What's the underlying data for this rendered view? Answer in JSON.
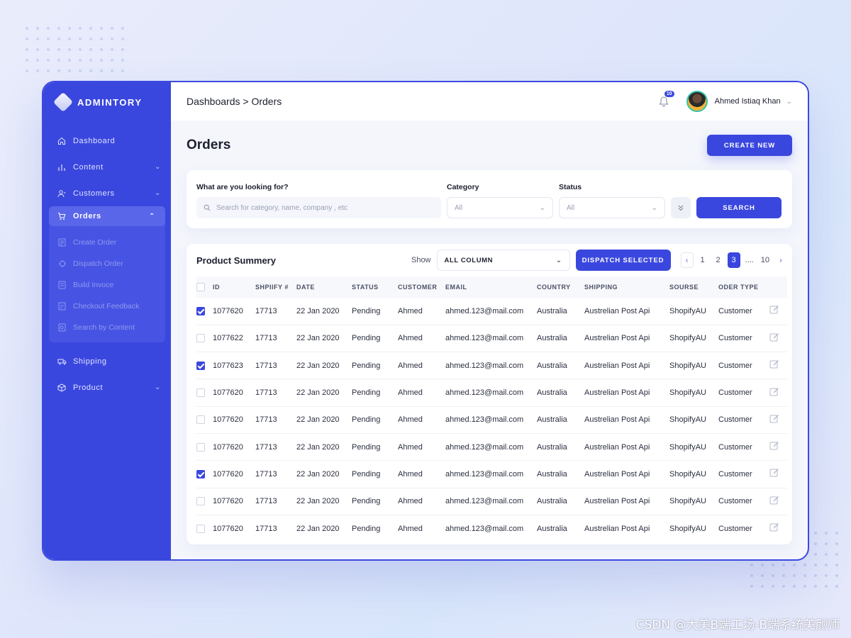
{
  "brand": {
    "name": "ADMINTORY"
  },
  "sidebar": {
    "items": [
      {
        "label": "Dashboard",
        "icon": "home-icon"
      },
      {
        "label": "Content",
        "icon": "bar-chart-icon"
      },
      {
        "label": "Customers",
        "icon": "user-icon"
      },
      {
        "label": "Orders",
        "icon": "cart-icon"
      },
      {
        "label": "Shipping",
        "icon": "truck-icon"
      },
      {
        "label": "Product",
        "icon": "box-icon"
      }
    ],
    "orders_sub": [
      {
        "label": "Create Order",
        "icon": "document-icon"
      },
      {
        "label": "Dispatch Order",
        "icon": "dispatch-icon"
      },
      {
        "label": "Build Invoce",
        "icon": "invoice-icon"
      },
      {
        "label": "Checkout Feedback",
        "icon": "feedback-icon"
      },
      {
        "label": "Search by Content",
        "icon": "search-doc-icon"
      }
    ]
  },
  "topbar": {
    "breadcrumb": "Dashboards > Orders",
    "notification_count": "10",
    "user_name": "Ahmed Istiaq Khan"
  },
  "page": {
    "title": "Orders",
    "create_label": "CREATE NEW"
  },
  "filters": {
    "search_label": "What are you looking for?",
    "search_placeholder": "Search for category, name, company , etc",
    "category_label": "Category",
    "category_value": "All",
    "status_label": "Status",
    "status_value": "All",
    "search_button": "SEARCH"
  },
  "summary": {
    "title": "Product Summery",
    "show_label": "Show",
    "column_select": "ALL COLUMN",
    "dispatch_label": "DISPATCH SELECTED",
    "pages": [
      "1",
      "2",
      "3",
      "....",
      "10"
    ],
    "current_page": "3"
  },
  "table": {
    "headers": [
      "ID",
      "SHPIIFY #",
      "DATE",
      "STATUS",
      "CUSTOMER",
      "EMAIL",
      "COUNTRY",
      "SHIPPING",
      "SOURSE",
      "ODER TYPE"
    ],
    "rows": [
      {
        "checked": true,
        "id": "1077620",
        "shopify": "17713",
        "date": "22 Jan 2020",
        "status": "Pending",
        "customer": "Ahmed",
        "email": "ahmed.123@mail.com",
        "country": "Australia",
        "shipping": "Austrelian Post Api",
        "source": "ShopifyAU",
        "type": "Customer"
      },
      {
        "checked": false,
        "id": "1077622",
        "shopify": "17713",
        "date": "22 Jan 2020",
        "status": "Pending",
        "customer": "Ahmed",
        "email": "ahmed.123@mail.com",
        "country": "Australia",
        "shipping": "Austrelian Post Api",
        "source": "ShopifyAU",
        "type": "Customer"
      },
      {
        "checked": true,
        "id": "1077623",
        "shopify": "17713",
        "date": "22 Jan 2020",
        "status": "Pending",
        "customer": "Ahmed",
        "email": "ahmed.123@mail.com",
        "country": "Australia",
        "shipping": "Austrelian Post Api",
        "source": "ShopifyAU",
        "type": "Customer"
      },
      {
        "checked": false,
        "id": "1077620",
        "shopify": "17713",
        "date": "22 Jan 2020",
        "status": "Pending",
        "customer": "Ahmed",
        "email": "ahmed.123@mail.com",
        "country": "Australia",
        "shipping": "Austrelian Post Api",
        "source": "ShopifyAU",
        "type": "Customer"
      },
      {
        "checked": false,
        "id": "1077620",
        "shopify": "17713",
        "date": "22 Jan 2020",
        "status": "Pending",
        "customer": "Ahmed",
        "email": "ahmed.123@mail.com",
        "country": "Australia",
        "shipping": "Austrelian Post Api",
        "source": "ShopifyAU",
        "type": "Customer"
      },
      {
        "checked": false,
        "id": "1077620",
        "shopify": "17713",
        "date": "22 Jan 2020",
        "status": "Pending",
        "customer": "Ahmed",
        "email": "ahmed.123@mail.com",
        "country": "Australia",
        "shipping": "Austrelian Post Api",
        "source": "ShopifyAU",
        "type": "Customer"
      },
      {
        "checked": true,
        "id": "1077620",
        "shopify": "17713",
        "date": "22 Jan 2020",
        "status": "Pending",
        "customer": "Ahmed",
        "email": "ahmed.123@mail.com",
        "country": "Australia",
        "shipping": "Austrelian Post Api",
        "source": "ShopifyAU",
        "type": "Customer"
      },
      {
        "checked": false,
        "id": "1077620",
        "shopify": "17713",
        "date": "22 Jan 2020",
        "status": "Pending",
        "customer": "Ahmed",
        "email": "ahmed.123@mail.com",
        "country": "Australia",
        "shipping": "Austrelian Post Api",
        "source": "ShopifyAU",
        "type": "Customer"
      },
      {
        "checked": false,
        "id": "1077620",
        "shopify": "17713",
        "date": "22 Jan 2020",
        "status": "Pending",
        "customer": "Ahmed",
        "email": "ahmed.123@mail.com",
        "country": "Australia",
        "shipping": "Austrelian Post Api",
        "source": "ShopifyAU",
        "type": "Customer"
      }
    ]
  },
  "watermark": "CSDN @大美B端工场-B端系统美颜师",
  "colors": {
    "accent": "#3a47de",
    "sidebar": "#3a47de",
    "background": "#f4f6fc"
  }
}
